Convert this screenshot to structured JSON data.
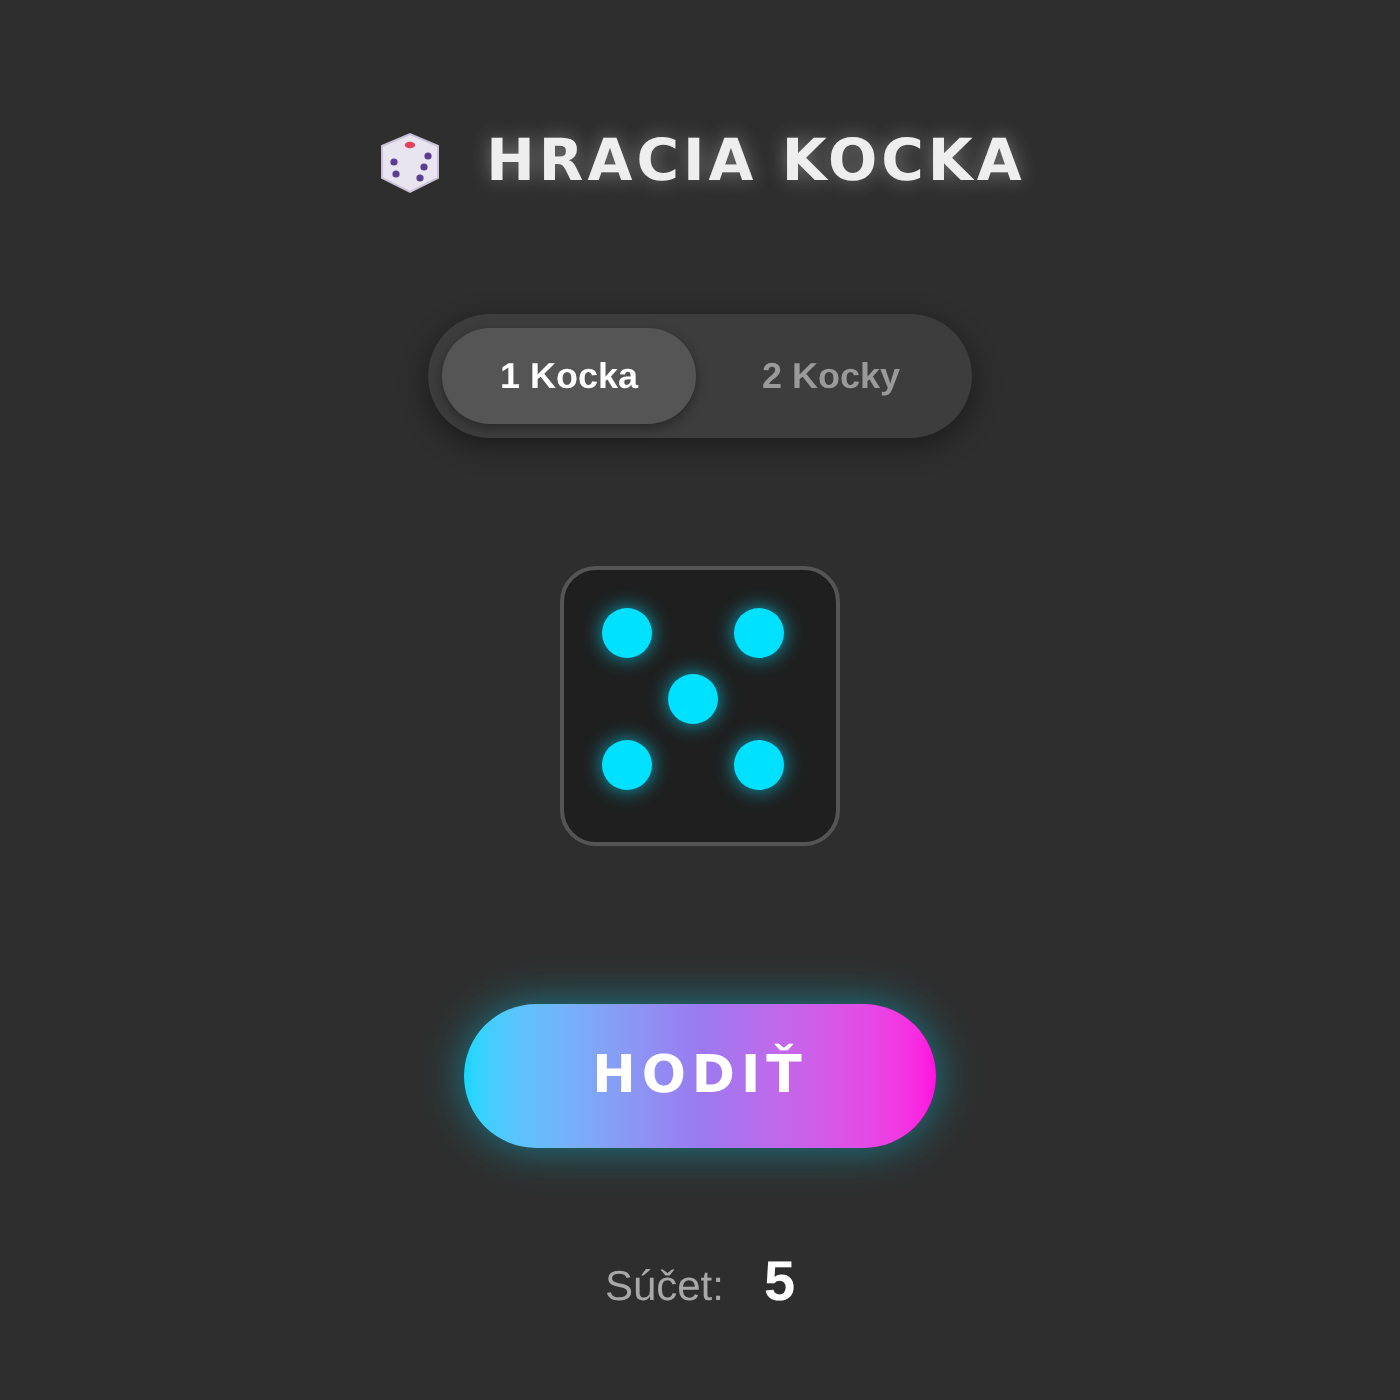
{
  "title": "HRACIA KOCKA",
  "mode_tabs": [
    {
      "label": "1 Kocka",
      "selected": true
    },
    {
      "label": "2 Kocky",
      "selected": false
    }
  ],
  "dice": [
    {
      "pips": [
        {
          "on": true
        },
        {
          "on": false
        },
        {
          "on": true
        },
        {
          "on": false
        },
        {
          "on": true
        },
        {
          "on": false
        },
        {
          "on": true
        },
        {
          "on": false
        },
        {
          "on": true
        }
      ]
    }
  ],
  "roll_button": "HODIŤ",
  "sum": {
    "label": "Súčet:",
    "value": "5"
  }
}
